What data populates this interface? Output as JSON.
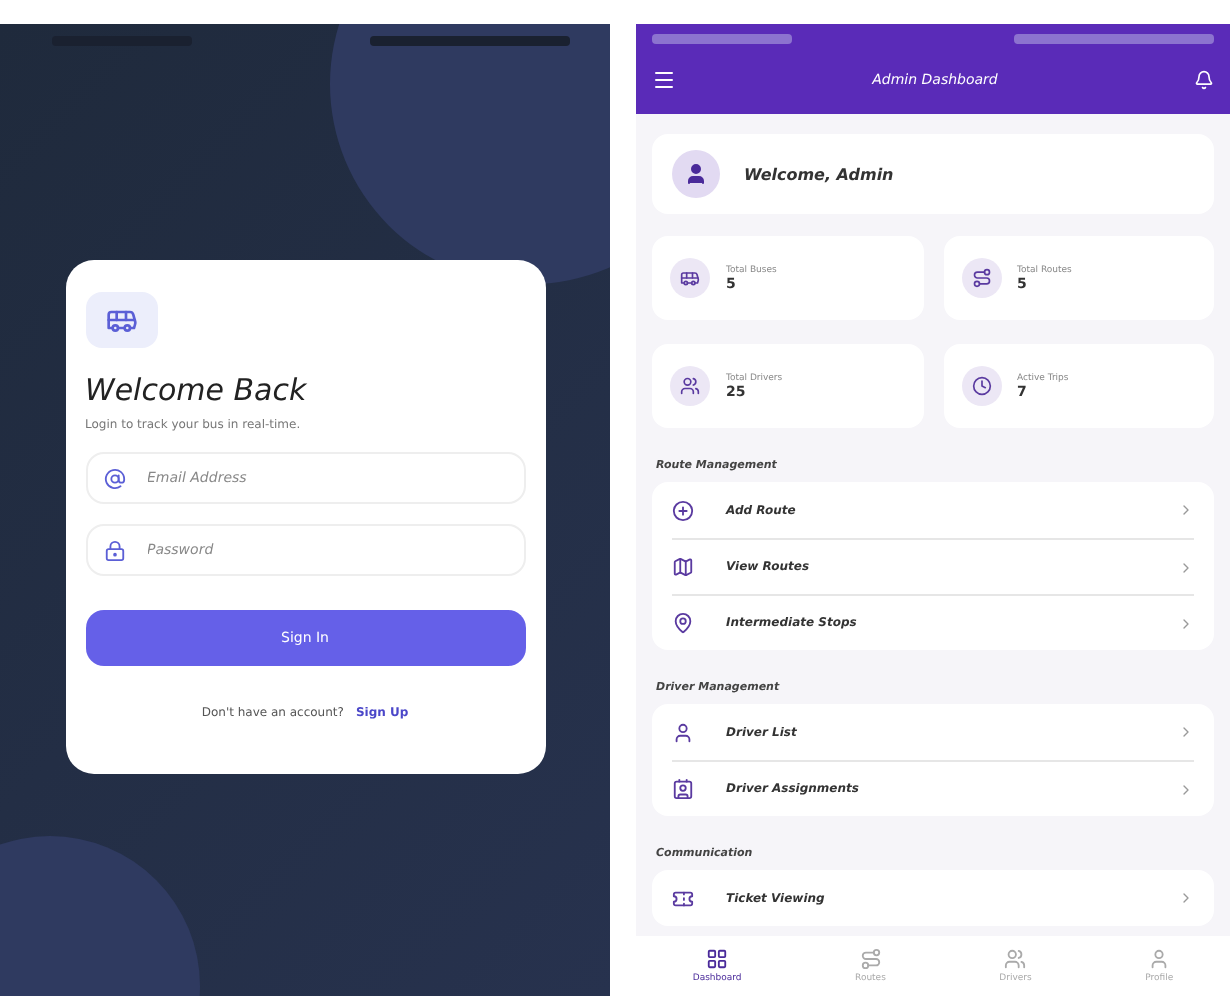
{
  "login": {
    "title": "Welcome Back",
    "subtitle": "Login to track your bus in real-time.",
    "fields": [
      {
        "kind": "email",
        "placeholder": "Email Address"
      },
      {
        "kind": "password",
        "placeholder": "Password"
      }
    ],
    "button": "Sign In",
    "prompt": "Don't have an account?",
    "link": "Sign Up"
  },
  "dashboard": {
    "title": "Admin Dashboard",
    "welcome": "Welcome, Admin",
    "stats": [
      {
        "kind": "bus",
        "label": "Total Buses",
        "value": "5"
      },
      {
        "kind": "route",
        "label": "Total Routes",
        "value": "5"
      },
      {
        "kind": "drivers",
        "label": "Total Drivers",
        "value": "25"
      },
      {
        "kind": "clock",
        "label": "Active Trips",
        "value": "7"
      }
    ],
    "sections": [
      {
        "title": "Route Management",
        "items": [
          {
            "kind": "add",
            "label": "Add Route"
          },
          {
            "kind": "map",
            "label": "View Routes"
          },
          {
            "kind": "pin",
            "label": "Intermediate Stops"
          }
        ]
      },
      {
        "title": "Driver Management",
        "items": [
          {
            "kind": "user",
            "label": "Driver List"
          },
          {
            "kind": "badge",
            "label": "Driver Assignments"
          }
        ]
      },
      {
        "title": "Communication",
        "items": [
          {
            "kind": "ticket",
            "label": "Ticket Viewing"
          }
        ]
      }
    ],
    "nav": [
      {
        "kind": "grid",
        "label": "Dashboard",
        "selected": true
      },
      {
        "kind": "route",
        "label": "Routes",
        "selected": false
      },
      {
        "kind": "drivers",
        "label": "Drivers",
        "selected": false
      },
      {
        "kind": "user",
        "label": "Profile",
        "selected": false
      }
    ]
  }
}
